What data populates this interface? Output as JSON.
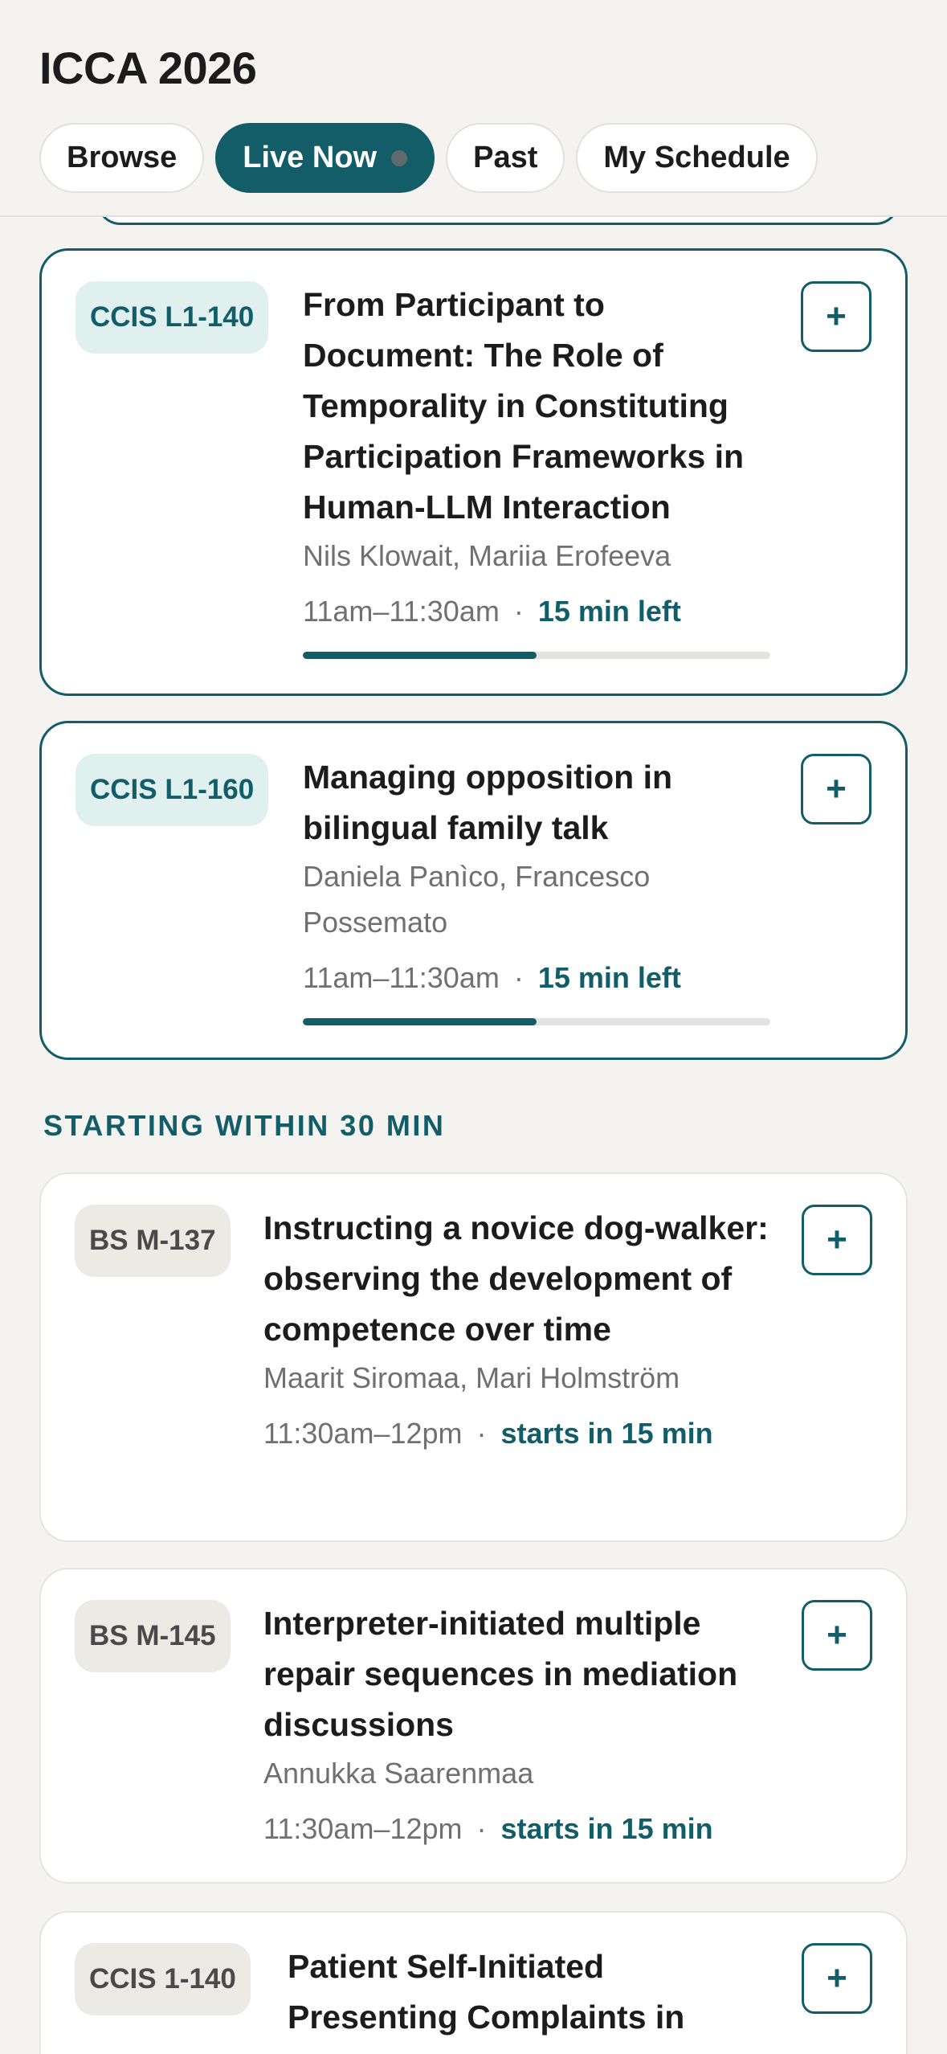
{
  "header": {
    "title": "ICCA 2026",
    "tabs": [
      {
        "label": "Browse"
      },
      {
        "label": "Live Now"
      },
      {
        "label": "Past"
      },
      {
        "label": "My Schedule"
      }
    ]
  },
  "colors": {
    "accent": "#125d68",
    "background": "#f4f3f0",
    "live_room_badge": "#dff0ef",
    "soon_room_badge": "#eceae5"
  },
  "add_label": "+",
  "live_sessions": [
    {
      "room": "CCIS L1-140",
      "title": "From Participant to Document: The Role of Temporality in Constituting Participation Frameworks in Human-LLM Interaction",
      "authors": "Nils Klowait, Mariia Erofeeva",
      "time": "11am–11:30am",
      "status": "15 min left",
      "progress_percent": 50
    },
    {
      "room": "CCIS L1-160",
      "title": "Managing opposition in bilingual family talk",
      "authors": "Daniela Panìco, Francesco Possemato",
      "time": "11am–11:30am",
      "status": "15 min left",
      "progress_percent": 50
    }
  ],
  "upcoming_section": {
    "label": "STARTING WITHIN 30 MIN",
    "sessions": [
      {
        "room": "BS M-137",
        "title": "Instructing a novice dog-walker: observing the development of competence over time",
        "authors": "Maarit Siromaa, Mari Holmström",
        "time": "11:30am–12pm",
        "status": "starts in 15 min"
      },
      {
        "room": "BS M-145",
        "title": "Interpreter-initiated multiple repair sequences in mediation discussions",
        "authors": "Annukka Saarenmaa",
        "time": "11:30am–12pm",
        "status": "starts in 15 min"
      },
      {
        "room": "CCIS 1-140",
        "title": "Patient Self-Initiated Presenting Complaints in"
      }
    ]
  }
}
